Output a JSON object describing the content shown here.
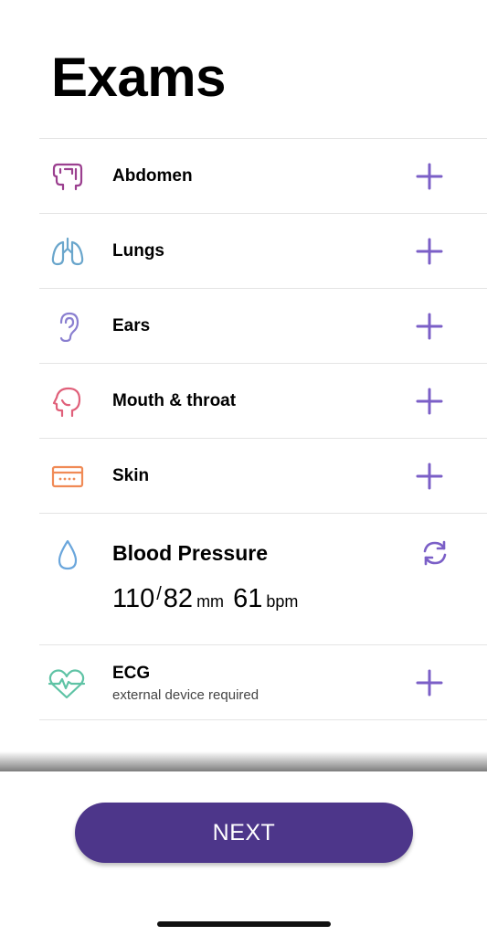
{
  "page": {
    "title": "Exams"
  },
  "colors": {
    "accent": "#7b5fc7",
    "button": "#4d368a",
    "abdomen": "#9b3f8f",
    "lungs": "#6aa6cc",
    "ears": "#8a7fd0",
    "mouth": "#e0607a",
    "skin": "#f08a55",
    "blood": "#6aa6dc",
    "ecg": "#5fc3a5"
  },
  "exams": [
    {
      "label": "Abdomen",
      "icon": "abdomen-icon",
      "action_icon": "plus-icon"
    },
    {
      "label": "Lungs",
      "icon": "lungs-icon",
      "action_icon": "plus-icon"
    },
    {
      "label": "Ears",
      "icon": "ear-icon",
      "action_icon": "plus-icon"
    },
    {
      "label": "Mouth & throat",
      "icon": "head-icon",
      "action_icon": "plus-icon"
    },
    {
      "label": "Skin",
      "icon": "skin-icon",
      "action_icon": "plus-icon"
    }
  ],
  "blood_pressure": {
    "label": "Blood Pressure",
    "icon": "drop-icon",
    "action_icon": "refresh-icon",
    "systolic": "110",
    "separator": "/",
    "diastolic": "82",
    "pressure_unit": "mm",
    "heart_rate": "61",
    "heart_rate_unit": "bpm"
  },
  "ecg": {
    "label": "ECG",
    "sublabel": "external device required",
    "icon": "heart-ecg-icon",
    "action_icon": "plus-icon"
  },
  "footer": {
    "next_label": "NEXT"
  }
}
